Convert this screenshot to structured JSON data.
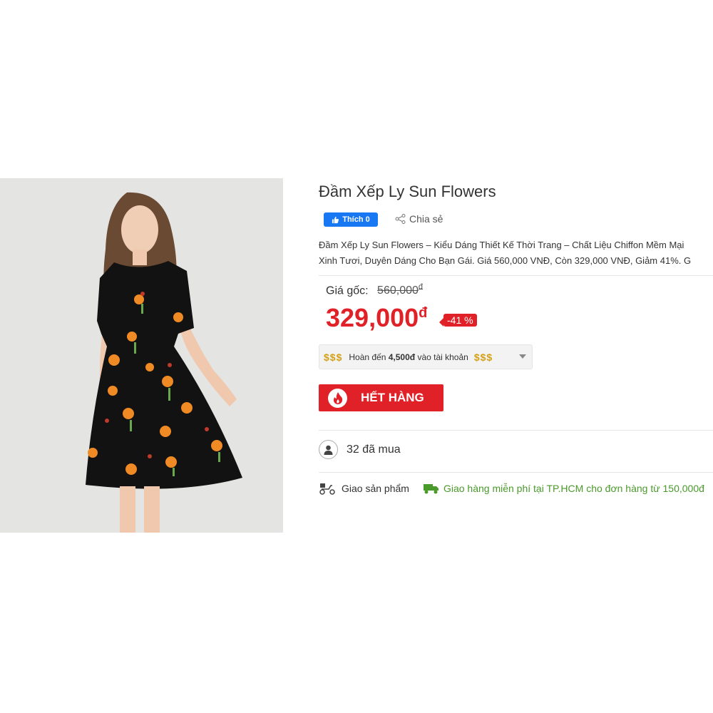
{
  "product": {
    "title": "Đầm Xếp Ly Sun Flowers",
    "image_alt": "dress-photo"
  },
  "social": {
    "like_label": "Thích 0",
    "share_label": "Chia sẻ"
  },
  "description": {
    "line1": "Đầm Xếp Ly Sun Flowers – Kiểu Dáng Thiết Kế Thời Trang – Chất Liệu Chiffon Mềm Mại",
    "line2": "Xinh Tươi, Duyên Dáng Cho Bạn Gái. Giá 560,000 VNĐ, Còn 329,000 VNĐ, Giảm 41%. G"
  },
  "pricing": {
    "original_label": "Giá gốc:",
    "original_price": "560,000",
    "currency": "đ",
    "sale_price": "329,000",
    "discount": "-41 %"
  },
  "cashback": {
    "dollar_signs": "$$$",
    "text_before": "Hoàn đến ",
    "amount": "4,500đ",
    "text_after": " vào tài khoản"
  },
  "sold_out": {
    "label": "HẾT HÀNG"
  },
  "buyers": {
    "label": "32 đã mua"
  },
  "shipping": {
    "label": "Giao sản phẩm",
    "free_text": "Giao hàng miễn phí tại TP.HCM cho đơn hàng từ 150,000đ"
  },
  "colors": {
    "accent_red": "#e02128",
    "facebook_blue": "#1877f2",
    "shipping_green": "#4a9a2b",
    "gold": "#d4a017"
  }
}
